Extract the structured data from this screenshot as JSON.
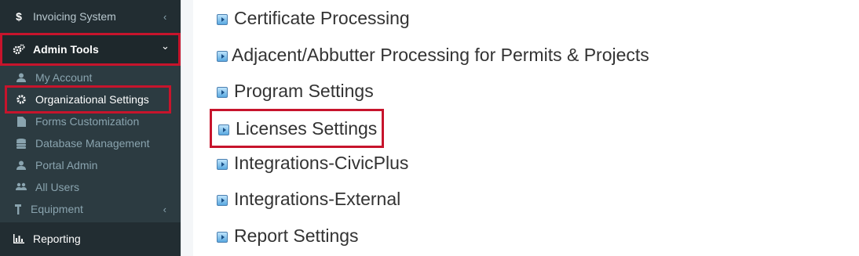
{
  "sidebar": {
    "top_items": [
      {
        "label": "Invoicing System",
        "icon": "dollar-icon",
        "chevron": "‹"
      },
      {
        "label": "Admin Tools",
        "icon": "gears-icon",
        "chevron": "⌄"
      },
      {
        "label": "Reporting",
        "icon": "bar-chart-icon"
      }
    ],
    "sub_items": [
      {
        "label": "My Account",
        "icon": "user-icon"
      },
      {
        "label": "Organizational Settings",
        "icon": "gear-icon"
      },
      {
        "label": "Forms Customization",
        "icon": "file-icon"
      },
      {
        "label": "Database Management",
        "icon": "database-icon"
      },
      {
        "label": "Portal Admin",
        "icon": "user-icon"
      },
      {
        "label": "All Users",
        "icon": "users-icon"
      },
      {
        "label": "Equipment",
        "icon": "tools-icon",
        "chevron": "‹"
      }
    ]
  },
  "content": {
    "links": [
      {
        "label": "Certificate Processing"
      },
      {
        "label": "Adjacent/Abbutter Processing for Permits & Projects"
      },
      {
        "label": "Program Settings"
      },
      {
        "label": "Licenses Settings"
      },
      {
        "label": "Integrations-CivicPlus"
      },
      {
        "label": "Integrations-External"
      },
      {
        "label": "Report Settings"
      }
    ]
  },
  "colors": {
    "sidebar_bg": "#222d32",
    "submenu_bg": "#2c3b41",
    "highlight_border": "#c7142c",
    "link_text": "#333333"
  }
}
